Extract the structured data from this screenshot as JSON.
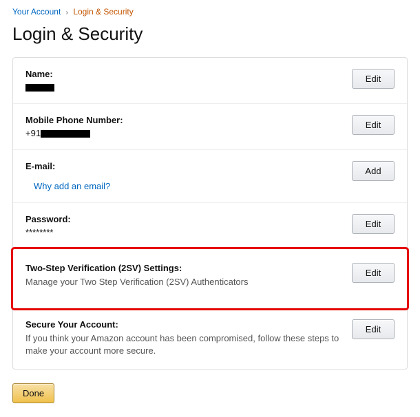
{
  "breadcrumb": {
    "account": "Your Account",
    "current": "Login & Security"
  },
  "page_title": "Login & Security",
  "rows": {
    "name": {
      "label": "Name:",
      "button": "Edit"
    },
    "phone": {
      "label": "Mobile Phone Number:",
      "prefix": "+91",
      "button": "Edit"
    },
    "email": {
      "label": "E-mail:",
      "help_link": "Why add an email?",
      "button": "Add"
    },
    "password": {
      "label": "Password:",
      "value": "********",
      "button": "Edit"
    },
    "tsv": {
      "label": "Two-Step Verification (2SV) Settings:",
      "desc": "Manage your Two Step Verification (2SV) Authenticators",
      "button": "Edit"
    },
    "secure": {
      "label": "Secure Your Account:",
      "desc": "If you think your Amazon account has been compromised, follow these steps to make your account more secure.",
      "button": "Edit"
    }
  },
  "done_button": "Done"
}
